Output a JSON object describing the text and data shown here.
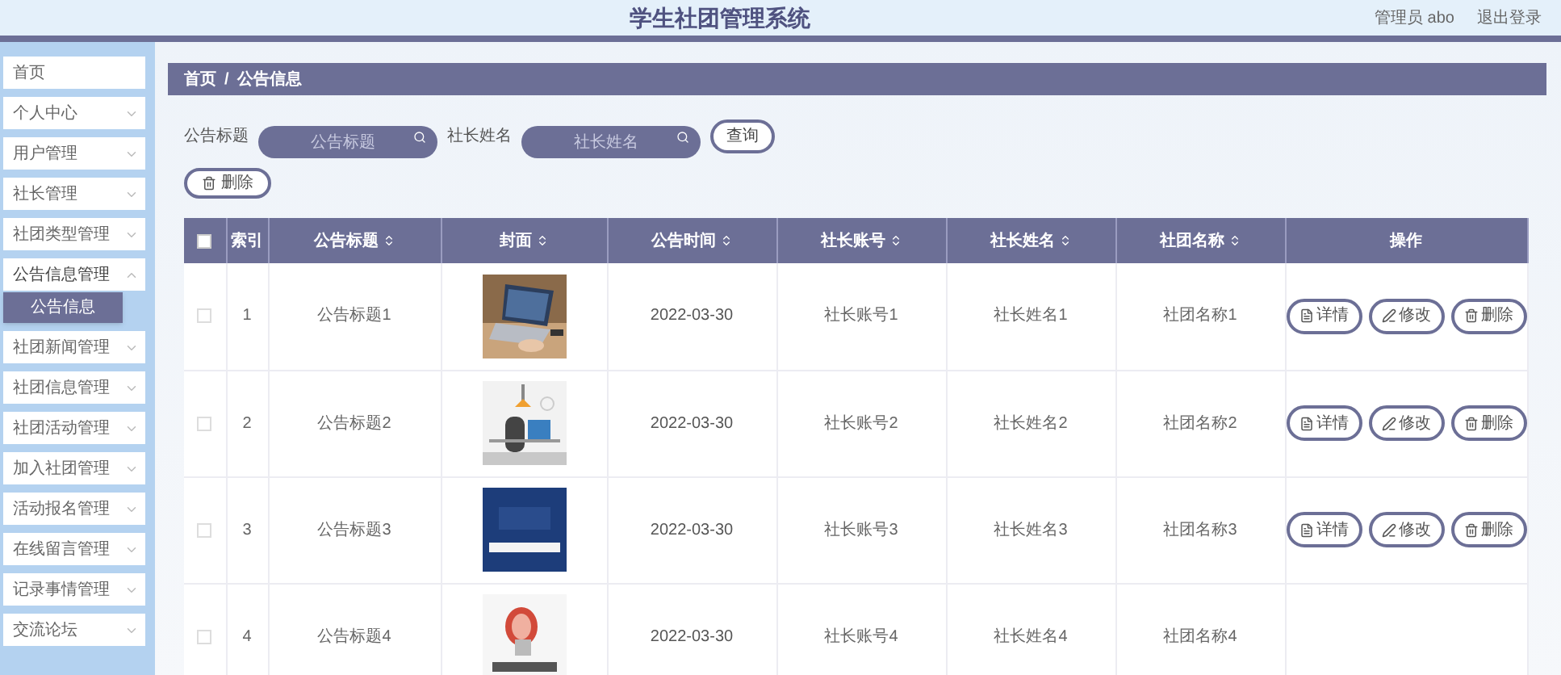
{
  "header": {
    "title": "学生社团管理系统",
    "user": "管理员 abo",
    "logout": "退出登录"
  },
  "sidebar": {
    "items": [
      {
        "label": "首页",
        "kind": "link"
      },
      {
        "label": "个人中心",
        "kind": "menu",
        "expanded": false
      },
      {
        "label": "用户管理",
        "kind": "menu",
        "expanded": false
      },
      {
        "label": "社长管理",
        "kind": "menu",
        "expanded": false
      },
      {
        "label": "社团类型管理",
        "kind": "menu",
        "expanded": false
      },
      {
        "label": "公告信息管理",
        "kind": "menu",
        "expanded": true,
        "children": [
          {
            "label": "公告信息",
            "selected": true
          }
        ]
      },
      {
        "label": "社团新闻管理",
        "kind": "menu",
        "expanded": false
      },
      {
        "label": "社团信息管理",
        "kind": "menu",
        "expanded": false
      },
      {
        "label": "社团活动管理",
        "kind": "menu",
        "expanded": false
      },
      {
        "label": "加入社团管理",
        "kind": "menu",
        "expanded": false
      },
      {
        "label": "活动报名管理",
        "kind": "menu",
        "expanded": false
      },
      {
        "label": "在线留言管理",
        "kind": "menu",
        "expanded": false
      },
      {
        "label": "记录事情管理",
        "kind": "menu",
        "expanded": false
      },
      {
        "label": "交流论坛",
        "kind": "menu",
        "expanded": false
      }
    ]
  },
  "breadcrumb": [
    "首页",
    "公告信息"
  ],
  "breadcrumb_separator": "/",
  "search": {
    "fields": [
      {
        "label": "公告标题",
        "placeholder": "公告标题"
      },
      {
        "label": "社长姓名",
        "placeholder": "社长姓名"
      }
    ],
    "button": "查询"
  },
  "delete_button": "删除",
  "table": {
    "select_all": {
      "checked": false
    },
    "columns": [
      {
        "label": "索引",
        "sortable": false
      },
      {
        "label": "公告标题",
        "sortable": true
      },
      {
        "label": "封面",
        "sortable": true
      },
      {
        "label": "公告时间",
        "sortable": true
      },
      {
        "label": "社长账号",
        "sortable": true
      },
      {
        "label": "社长姓名",
        "sortable": true
      },
      {
        "label": "社团名称",
        "sortable": true
      },
      {
        "label": "操作",
        "sortable": false
      }
    ],
    "rows": [
      {
        "checked": false,
        "index": "1",
        "title": "公告标题1",
        "time": "2022-03-30",
        "account": "社长账号1",
        "name": "社长姓名1",
        "club": "社团名称1",
        "actions": [
          "详情",
          "修改",
          "删除"
        ]
      },
      {
        "checked": false,
        "index": "2",
        "title": "公告标题2",
        "time": "2022-03-30",
        "account": "社长账号2",
        "name": "社长姓名2",
        "club": "社团名称2",
        "actions": [
          "详情",
          "修改",
          "删除"
        ]
      },
      {
        "checked": false,
        "index": "3",
        "title": "公告标题3",
        "time": "2022-03-30",
        "account": "社长账号3",
        "name": "社长姓名3",
        "club": "社团名称3",
        "actions": [
          "详情",
          "修改",
          "删除"
        ]
      },
      {
        "checked": false,
        "index": "4",
        "title": "公告标题4",
        "time": "2022-03-30",
        "account": "社长账号4",
        "name": "社长姓名4",
        "club": "社团名称4"
      }
    ]
  }
}
